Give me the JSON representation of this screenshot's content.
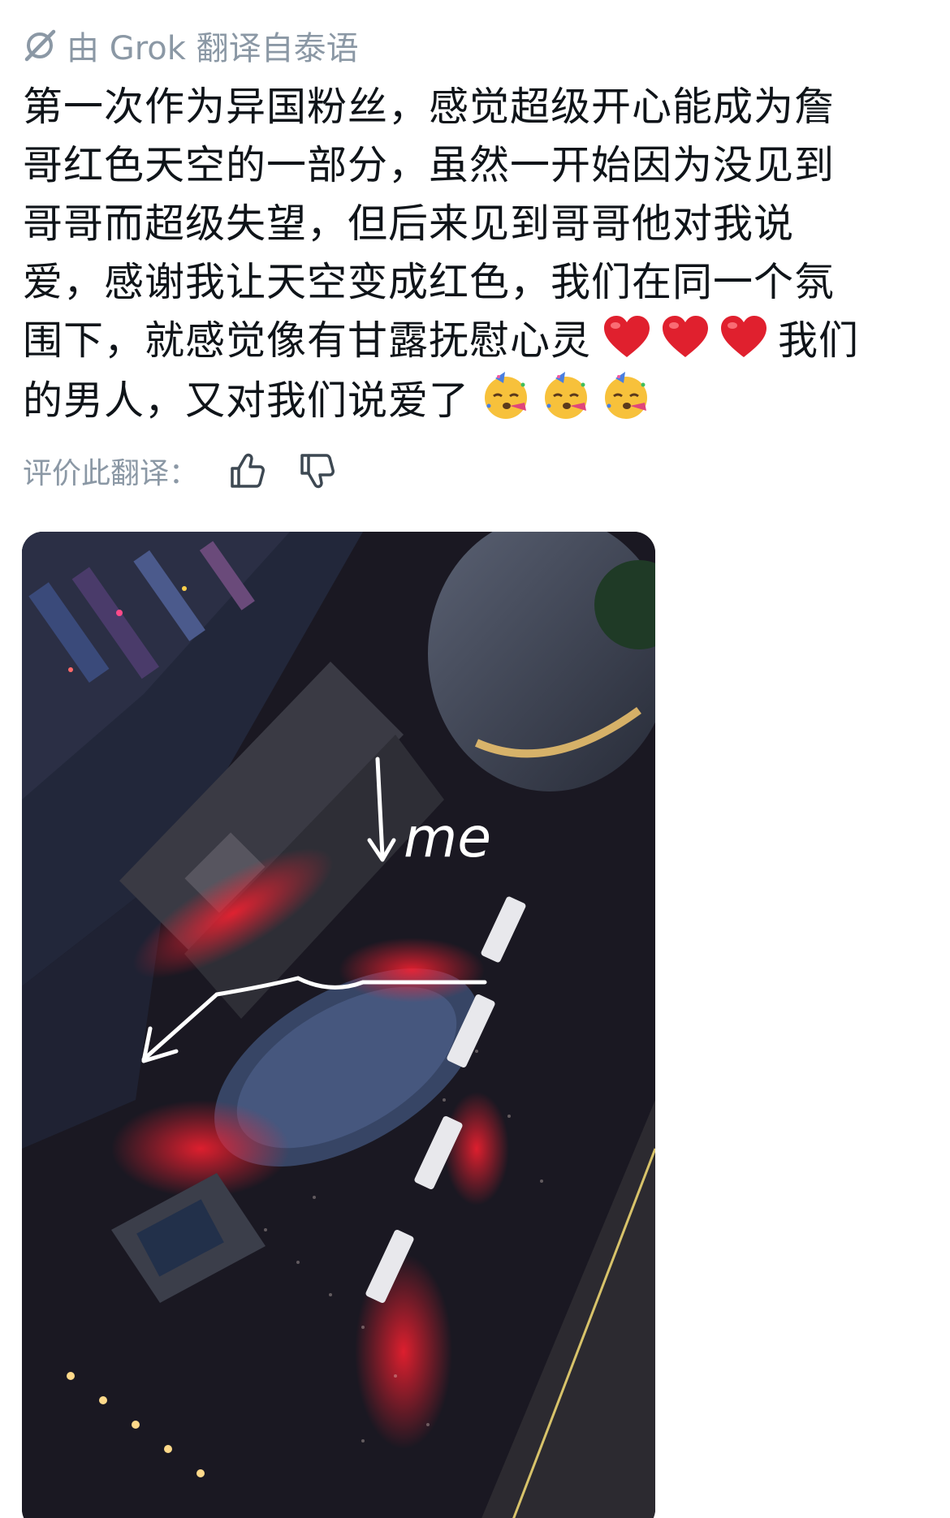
{
  "translation": {
    "label": "由 Grok 翻译自泰语",
    "icon": "grok-icon",
    "color": "#8b98a5"
  },
  "post": {
    "lines": [
      "第一次作为异国粉丝，感觉超级开心能成为詹",
      "哥红色天空的一部分，虽然一开始因为没见到",
      "哥哥而超级失望，但后来见到哥哥他对我说",
      "爱，感谢我让天空变成红色，我们在同一个氛",
      "围下，就感觉像有甘露抚慰心灵",
      "我们",
      "的男人，又对我们说爱了"
    ],
    "emojis": [
      "heart-emoji",
      "heart-emoji",
      "heart-emoji",
      "party-face-emoji",
      "party-face-emoji",
      "party-face-emoji"
    ],
    "text_color": "#0f1419"
  },
  "rating": {
    "label": "评价此翻译：",
    "thumbs_up_icon": "thumbs-up-icon",
    "thumbs_down_icon": "thumbs-down-icon"
  },
  "photo": {
    "annotation": "me",
    "description_icon": "aerial-night-crowd-photo"
  }
}
